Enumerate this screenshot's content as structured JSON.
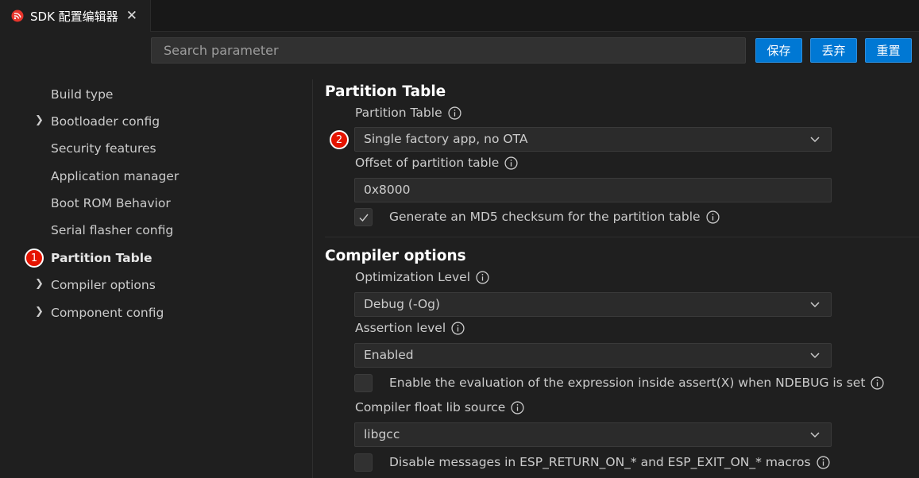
{
  "tab": {
    "title": "SDK 配置编辑器",
    "close": "✕"
  },
  "search": {
    "placeholder": "Search parameter"
  },
  "toolbar": {
    "save": "保存",
    "discard": "丢弃",
    "reset": "重置"
  },
  "sidebar": {
    "items": [
      {
        "label": "Build type",
        "expandable": false
      },
      {
        "label": "Bootloader config",
        "expandable": true
      },
      {
        "label": "Security features",
        "expandable": false
      },
      {
        "label": "Application manager",
        "expandable": false
      },
      {
        "label": "Boot ROM Behavior",
        "expandable": false
      },
      {
        "label": "Serial flasher config",
        "expandable": false
      },
      {
        "label": "Partition Table",
        "expandable": false,
        "active": true
      },
      {
        "label": "Compiler options",
        "expandable": true
      },
      {
        "label": "Component config",
        "expandable": true
      }
    ],
    "badge": "1"
  },
  "partition": {
    "title": "Partition Table",
    "table_label": "Partition Table",
    "table_value": "Single factory app, no OTA",
    "badge": "2",
    "offset_label": "Offset of partition table",
    "offset_value": "0x8000",
    "md5_label": "Generate an MD5 checksum for the partition table",
    "md5_checked": true
  },
  "compiler": {
    "title": "Compiler options",
    "opt_label": "Optimization Level",
    "opt_value": "Debug (-Og)",
    "assert_label": "Assertion level",
    "assert_value": "Enabled",
    "eval_label": "Enable the evaluation of the expression inside assert(X) when NDEBUG is set",
    "eval_checked": false,
    "float_label": "Compiler float lib source",
    "float_value": "libgcc",
    "disable_label": "Disable messages in ESP_RETURN_ON_* and ESP_EXIT_ON_* macros",
    "disable_checked": false
  },
  "colors": {
    "accent": "#0078d4",
    "badge": "#e51400",
    "background": "#1f1f1f"
  }
}
